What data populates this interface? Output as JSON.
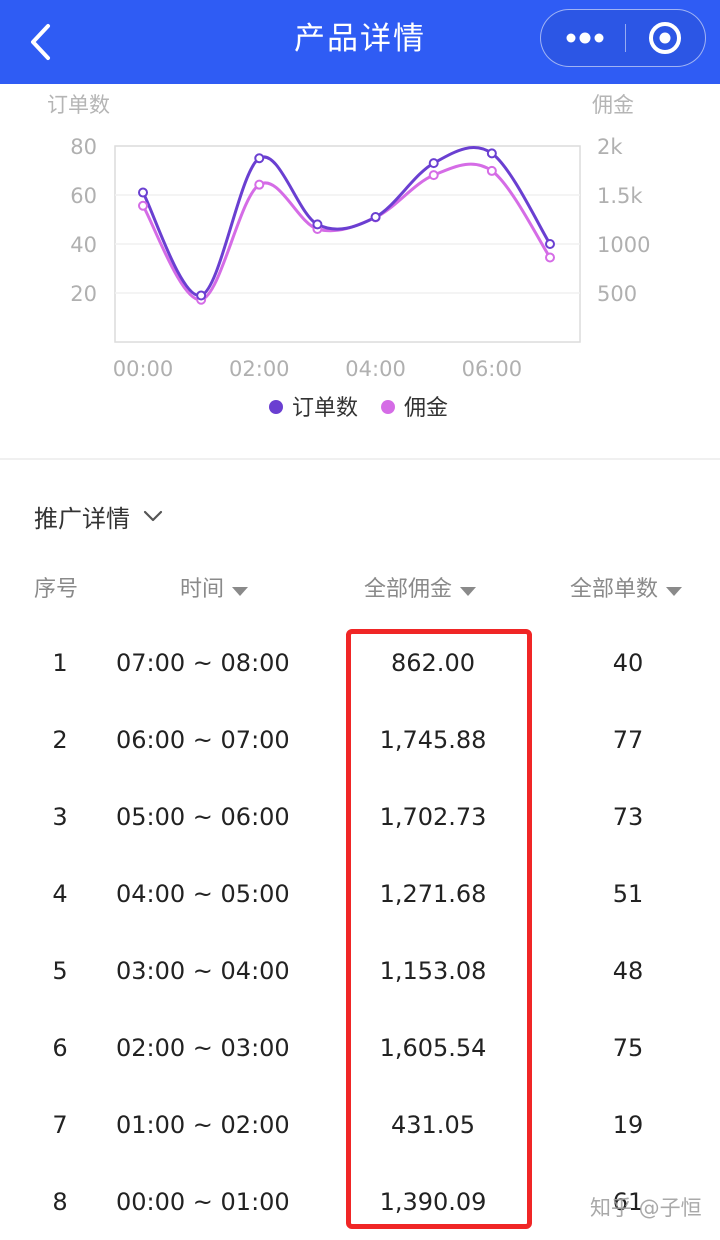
{
  "header": {
    "title": "产品详情",
    "icons": {
      "back": "back-chevron-icon",
      "more": "more-dots-icon",
      "target": "target-circle-icon"
    },
    "color": "#2f5cf4"
  },
  "chart_data": {
    "type": "line",
    "y_left_label": "订单数",
    "y_right_label": "佣金",
    "x": [
      "00:00",
      "01:00",
      "02:00",
      "03:00",
      "04:00",
      "05:00",
      "06:00",
      "07:00"
    ],
    "x_ticks": [
      "00:00",
      "02:00",
      "04:00",
      "06:00"
    ],
    "ylim_left": [
      0,
      80
    ],
    "ylim_right": [
      0,
      2000
    ],
    "y_left_ticks": [
      "80",
      "60",
      "40",
      "20"
    ],
    "y_right_ticks": [
      "2k",
      "1.5k",
      "1000",
      "500"
    ],
    "grid": true,
    "legend_position": "bottom",
    "series": [
      {
        "name": "订单数",
        "axis": "left",
        "color": "#6a3fd1",
        "values": [
          61,
          19,
          75,
          48,
          51,
          73,
          77,
          40
        ]
      },
      {
        "name": "佣金",
        "axis": "right",
        "color": "#d56ce6",
        "values": [
          1390.09,
          431.05,
          1605.54,
          1153.08,
          1271.68,
          1702.73,
          1745.88,
          862.0
        ]
      }
    ]
  },
  "section": {
    "title": "推广详情",
    "icon": "chevron-down-icon"
  },
  "table": {
    "columns": [
      {
        "label": "序号",
        "sortable": false
      },
      {
        "label": "时间",
        "sortable": true
      },
      {
        "label": "全部佣金",
        "sortable": true
      },
      {
        "label": "全部单数",
        "sortable": true
      }
    ],
    "rows": [
      {
        "idx": "1",
        "time": "07:00 ~ 08:00",
        "commission": "862.00",
        "count": "40"
      },
      {
        "idx": "2",
        "time": "06:00 ~ 07:00",
        "commission": "1,745.88",
        "count": "77"
      },
      {
        "idx": "3",
        "time": "05:00 ~ 06:00",
        "commission": "1,702.73",
        "count": "73"
      },
      {
        "idx": "4",
        "time": "04:00 ~ 05:00",
        "commission": "1,271.68",
        "count": "51"
      },
      {
        "idx": "5",
        "time": "03:00 ~ 04:00",
        "commission": "1,153.08",
        "count": "48"
      },
      {
        "idx": "6",
        "time": "02:00 ~ 03:00",
        "commission": "1,605.54",
        "count": "75"
      },
      {
        "idx": "7",
        "time": "01:00 ~ 02:00",
        "commission": "431.05",
        "count": "19"
      },
      {
        "idx": "8",
        "time": "00:00 ~ 01:00",
        "commission": "1,390.09",
        "count": "61"
      }
    ]
  },
  "highlight_color": "#f02626",
  "watermark": "知乎 @子恒"
}
